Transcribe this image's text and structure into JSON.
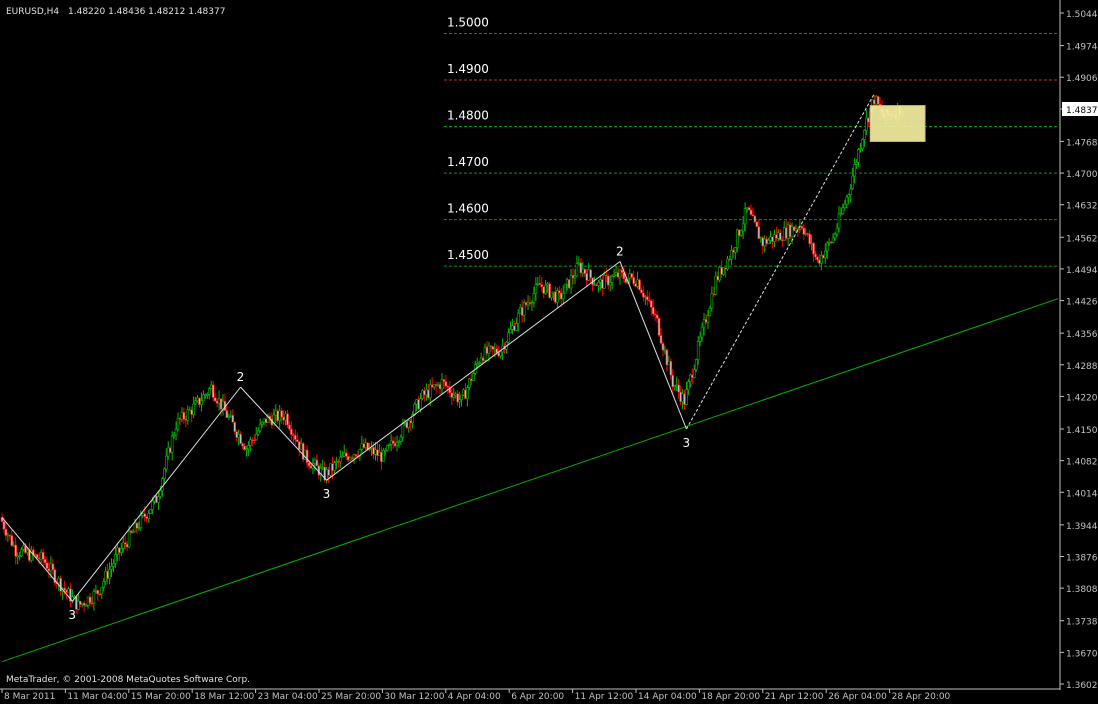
{
  "header": {
    "symbol_label": "EURUSD,H4",
    "ohlc_label": "1.48220 1.48436 1.48212 1.48377"
  },
  "footer": {
    "copyright": "MetaTrader, © 2001-2008 MetaQuotes Software Corp."
  },
  "colors": {
    "background": "#000000",
    "axis": "#c0c0c0",
    "bull_candle": "#00c000",
    "bear_candle": "#ff0000",
    "candle_body": "#c0c0c0",
    "level_red": "#c03030",
    "level_green": "#00a000",
    "trendline": "#00b400",
    "wave_line": "#e0e0e0",
    "box_fill": "#f5eea0",
    "price_tag_bg": "#ffffff"
  },
  "price_axis": {
    "current_price": "1.48377",
    "labels": [
      "1.50440",
      "1.49740",
      "1.49060",
      "1.48377",
      "1.47680",
      "1.47000",
      "1.46320",
      "1.45620",
      "1.44940",
      "1.44260",
      "1.43560",
      "1.42880",
      "1.42200",
      "1.41500",
      "1.40820",
      "1.40140",
      "1.39440",
      "1.38760",
      "1.38080",
      "1.37380",
      "1.36700",
      "1.36020"
    ]
  },
  "time_axis": {
    "labels": [
      "8 Mar 2011",
      "11 Mar 04:00",
      "15 Mar 20:00",
      "18 Mar 12:00",
      "23 Mar 04:00",
      "25 Mar 20:00",
      "30 Mar 12:00",
      "4 Apr 04:00",
      "6 Apr 20:00",
      "11 Apr 12:00",
      "14 Apr 04:00",
      "18 Apr 20:00",
      "21 Apr 12:00",
      "26 Apr 04:00",
      "28 Apr 20:00"
    ]
  },
  "levels": [
    {
      "label": "1.5000",
      "color": "red"
    },
    {
      "label": "1.4900",
      "color": "red"
    },
    {
      "label": "1.4800",
      "color": "green"
    },
    {
      "label": "1.4700",
      "color": "green"
    },
    {
      "label": "1.4600",
      "color": "green"
    },
    {
      "label": "1.4500",
      "color": "green"
    }
  ],
  "wave_labels": [
    "3",
    "2",
    "3",
    "2",
    "3"
  ],
  "chart_data": {
    "type": "candlestick",
    "symbol": "EURUSD",
    "timeframe": "H4",
    "ohlc_last": {
      "open": 1.4822,
      "high": 1.48436,
      "low": 1.48212,
      "close": 1.48377
    },
    "anchors": [
      {
        "x": 0,
        "price": 1.396
      },
      {
        "x": 8,
        "price": 1.389
      },
      {
        "x": 22,
        "price": 1.387
      },
      {
        "x": 32,
        "price": 1.381
      },
      {
        "x": 40,
        "price": 1.377
      },
      {
        "x": 50,
        "price": 1.38
      },
      {
        "x": 60,
        "price": 1.388
      },
      {
        "x": 70,
        "price": 1.394
      },
      {
        "x": 80,
        "price": 1.4
      },
      {
        "x": 90,
        "price": 1.416
      },
      {
        "x": 100,
        "price": 1.42
      },
      {
        "x": 108,
        "price": 1.424
      },
      {
        "x": 116,
        "price": 1.418
      },
      {
        "x": 126,
        "price": 1.411
      },
      {
        "x": 136,
        "price": 1.417
      },
      {
        "x": 146,
        "price": 1.418
      },
      {
        "x": 156,
        "price": 1.409
      },
      {
        "x": 166,
        "price": 1.405
      },
      {
        "x": 176,
        "price": 1.409
      },
      {
        "x": 186,
        "price": 1.411
      },
      {
        "x": 196,
        "price": 1.409
      },
      {
        "x": 206,
        "price": 1.415
      },
      {
        "x": 216,
        "price": 1.422
      },
      {
        "x": 226,
        "price": 1.425
      },
      {
        "x": 236,
        "price": 1.421
      },
      {
        "x": 246,
        "price": 1.431
      },
      {
        "x": 256,
        "price": 1.432
      },
      {
        "x": 266,
        "price": 1.44
      },
      {
        "x": 276,
        "price": 1.446
      },
      {
        "x": 286,
        "price": 1.443
      },
      {
        "x": 296,
        "price": 1.45
      },
      {
        "x": 306,
        "price": 1.446
      },
      {
        "x": 316,
        "price": 1.448
      },
      {
        "x": 326,
        "price": 1.447
      },
      {
        "x": 336,
        "price": 1.438
      },
      {
        "x": 344,
        "price": 1.425
      },
      {
        "x": 350,
        "price": 1.421
      },
      {
        "x": 358,
        "price": 1.434
      },
      {
        "x": 366,
        "price": 1.447
      },
      {
        "x": 374,
        "price": 1.453
      },
      {
        "x": 382,
        "price": 1.462
      },
      {
        "x": 390,
        "price": 1.455
      },
      {
        "x": 400,
        "price": 1.457
      },
      {
        "x": 410,
        "price": 1.459
      },
      {
        "x": 418,
        "price": 1.451
      },
      {
        "x": 426,
        "price": 1.456
      },
      {
        "x": 434,
        "price": 1.466
      },
      {
        "x": 442,
        "price": 1.48
      },
      {
        "x": 447,
        "price": 1.486
      },
      {
        "x": 452,
        "price": 1.482
      },
      {
        "x": 460,
        "price": 1.4838
      }
    ],
    "levels": [
      1.5,
      1.49,
      1.48,
      1.47,
      1.46,
      1.45
    ],
    "box": {
      "price_top": 1.4845,
      "price_bottom": 1.4768,
      "x_start": 444,
      "x_end": 472
    },
    "trendline": {
      "x1": 0,
      "price1": 1.365,
      "x2": 540,
      "price2": 1.443
    },
    "wave_points": [
      {
        "x": 0,
        "price": 1.396,
        "label": ""
      },
      {
        "x": 36,
        "price": 1.378,
        "label": "3"
      },
      {
        "x": 122,
        "price": 1.424,
        "label": "2"
      },
      {
        "x": 166,
        "price": 1.404,
        "label": "3"
      },
      {
        "x": 316,
        "price": 1.451,
        "label": "2"
      },
      {
        "x": 350,
        "price": 1.415,
        "label": "3"
      }
    ],
    "wave_dashed": [
      {
        "x": 350,
        "price": 1.415
      },
      {
        "x": 446,
        "price": 1.487
      }
    ],
    "ylim": [
      1.3602,
      1.5044
    ],
    "xlim": [
      0,
      540
    ]
  }
}
